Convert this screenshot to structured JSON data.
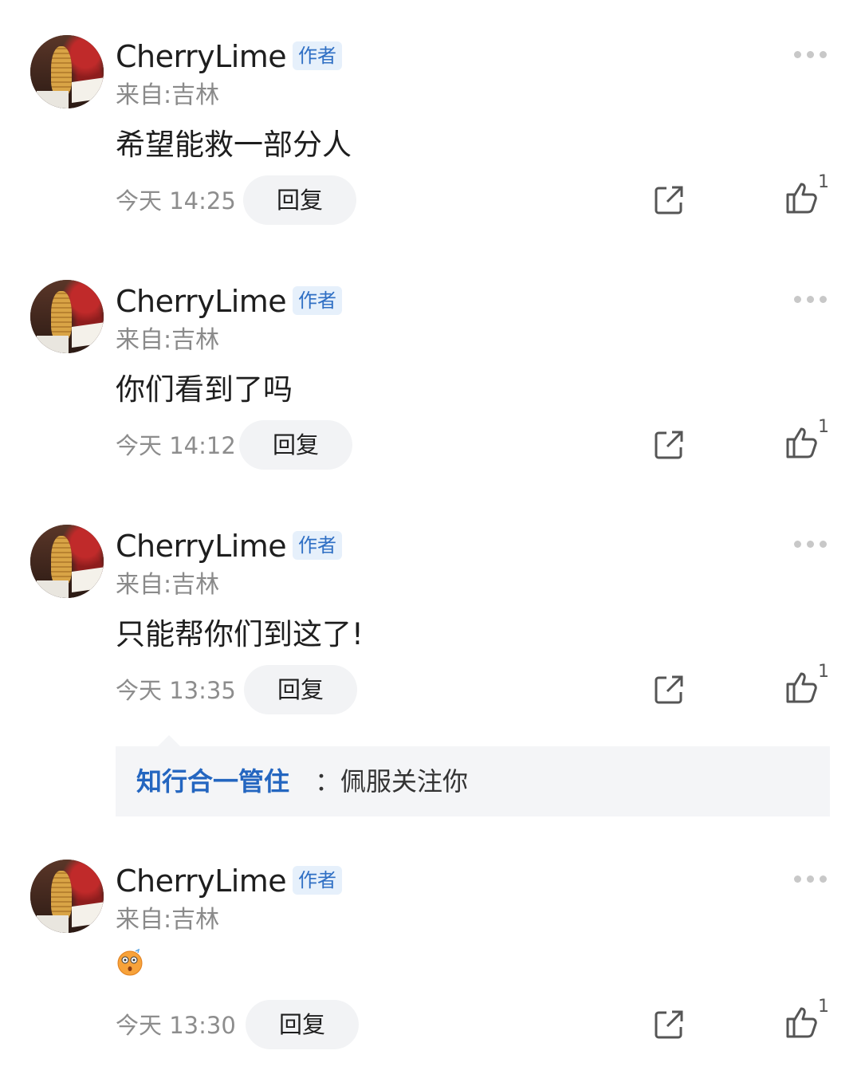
{
  "comments": [
    {
      "author": "CherryLime",
      "badge": "作者",
      "location": "来自:吉林",
      "text": "希望能救一部分人",
      "time": "今天 14:25",
      "reply": "回复",
      "likes": "1",
      "emoji": ""
    },
    {
      "author": "CherryLime",
      "badge": "作者",
      "location": "来自:吉林",
      "text": "你们看到了吗",
      "time": "今天 14:12",
      "reply": "回复",
      "likes": "1",
      "emoji": ""
    },
    {
      "author": "CherryLime",
      "badge": "作者",
      "location": "来自:吉林",
      "text": "只能帮你们到这了!",
      "time": "今天 13:35",
      "reply": "回复",
      "likes": "1",
      "emoji": ""
    },
    {
      "author": "CherryLime",
      "badge": "作者",
      "location": "来自:吉林",
      "text": "",
      "time": "今天 13:30",
      "reply": "回复",
      "likes": "1",
      "emoji": "dizzy-face-emoji"
    }
  ],
  "sub_reply": {
    "name": "知行合一管住",
    "separator": "：",
    "text": "佩服关注你"
  },
  "colors": {
    "badge_bg": "#e6f0fb",
    "badge_text": "#2f6fc4",
    "link_blue": "#2466c0",
    "reply_bg": "#f2f3f5"
  },
  "icons": {
    "more": "more-dots-icon",
    "share": "share-icon",
    "like": "thumbs-up-icon"
  }
}
